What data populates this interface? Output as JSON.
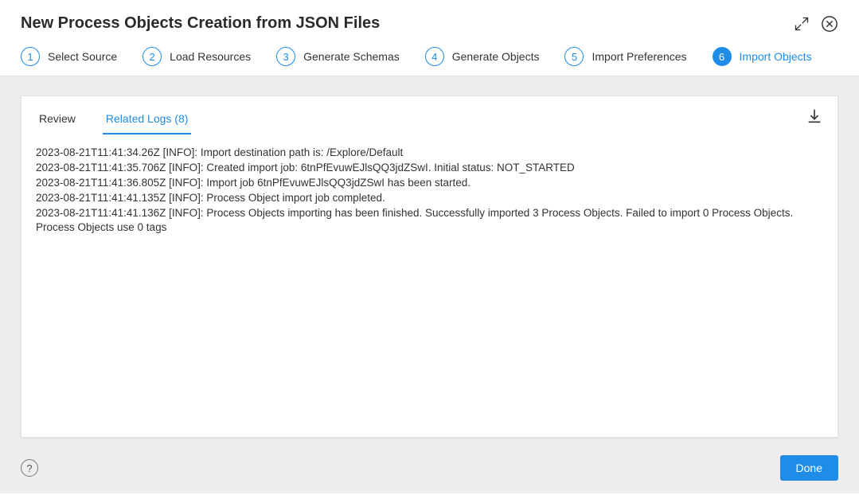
{
  "header": {
    "title": "New Process Objects Creation from JSON Files"
  },
  "steps": [
    {
      "num": "1",
      "label": "Select Source"
    },
    {
      "num": "2",
      "label": "Load Resources"
    },
    {
      "num": "3",
      "label": "Generate Schemas"
    },
    {
      "num": "4",
      "label": "Generate Objects"
    },
    {
      "num": "5",
      "label": "Import Preferences"
    },
    {
      "num": "6",
      "label": "Import Objects"
    }
  ],
  "tabs": {
    "review": "Review",
    "related_logs": "Related Logs (8)"
  },
  "logs": [
    "2023-08-21T11:41:34.26Z [INFO]: Import destination path is: /Explore/Default",
    "2023-08-21T11:41:35.706Z [INFO]: Created import job: 6tnPfEvuwEJlsQQ3jdZSwI. Initial status: NOT_STARTED",
    "2023-08-21T11:41:36.805Z [INFO]: Import job 6tnPfEvuwEJlsQQ3jdZSwI has been started.",
    "2023-08-21T11:41:41.135Z [INFO]: Process Object import job completed.",
    "2023-08-21T11:41:41.136Z [INFO]: Process Objects importing has been finished. Successfully imported 3 Process Objects. Failed to import 0 Process Objects. Process Objects use 0 tags"
  ],
  "footer": {
    "done": "Done",
    "help": "?"
  }
}
